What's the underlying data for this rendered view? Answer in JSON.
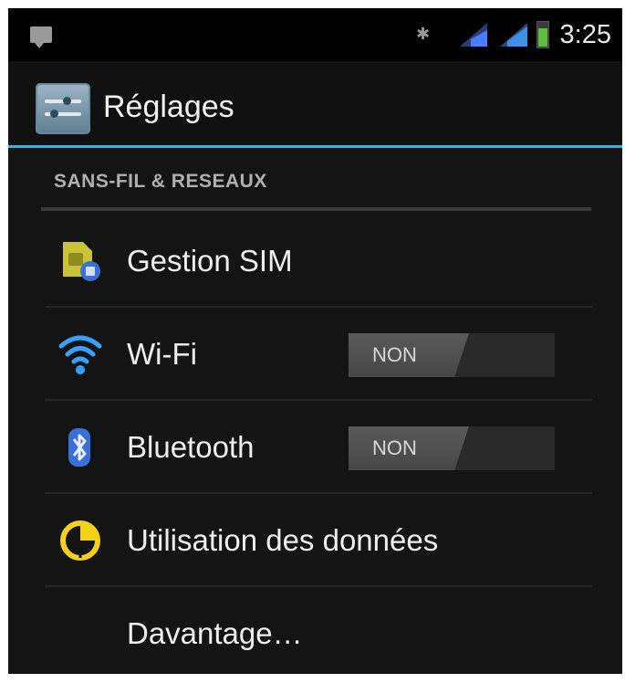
{
  "status_bar": {
    "time": "3:25",
    "icons": [
      "notification-icon",
      "mute-icon",
      "signal-1-icon",
      "signal-2-icon",
      "battery-icon"
    ],
    "signal_color": "#4a7cff",
    "battery_color": "#5fbf3a"
  },
  "action_bar": {
    "title": "Réglages",
    "icon": "settings-app-icon",
    "accent_color": "#33b5e5"
  },
  "section": {
    "header": "SANS-FIL & RESEAUX"
  },
  "items": [
    {
      "label": "Gestion SIM",
      "icon": "sim-card-icon"
    },
    {
      "label": "Wi-Fi",
      "icon": "wifi-icon",
      "toggle": "NON"
    },
    {
      "label": "Bluetooth",
      "icon": "bluetooth-icon",
      "toggle": "NON"
    },
    {
      "label": "Utilisation des données",
      "icon": "data-usage-icon"
    },
    {
      "label": "Davantage…"
    }
  ]
}
